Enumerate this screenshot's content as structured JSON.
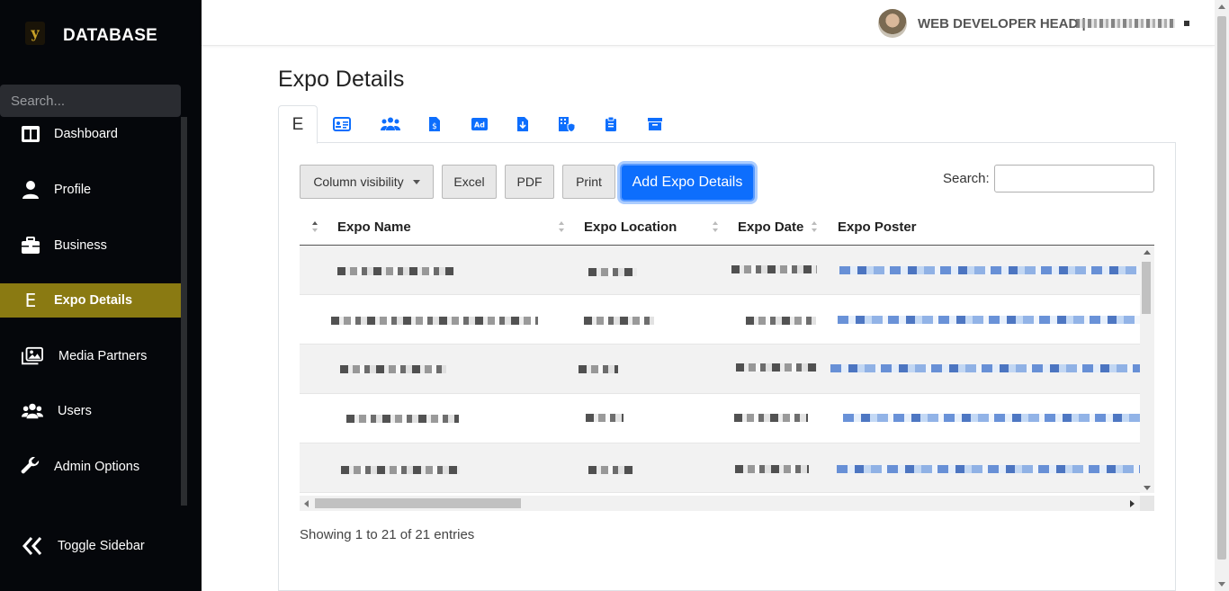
{
  "brand": {
    "logo_letter": "y",
    "name": "DATABASE"
  },
  "sidebar": {
    "search_placeholder": "Search...",
    "items": [
      {
        "label": "Dashboard",
        "icon": "columns-icon"
      },
      {
        "label": "Profile",
        "icon": "user-icon"
      },
      {
        "label": "Business",
        "icon": "briefcase-icon"
      },
      {
        "label": "Expo Details",
        "icon": "letter-e-icon",
        "icon_text": "E",
        "active": true
      },
      {
        "label": "Media Partners",
        "icon": "images-icon"
      },
      {
        "label": "Users",
        "icon": "users-icon"
      },
      {
        "label": "Admin Options",
        "icon": "wrench-icon"
      }
    ],
    "toggle_label": "Toggle Sidebar"
  },
  "topbar": {
    "user_role": "WEB DEVELOPER HEAD |"
  },
  "page": {
    "title": "Expo Details"
  },
  "tabs": [
    {
      "icon": "letter-e-icon",
      "text": "E",
      "active": true
    },
    {
      "icon": "id-card-icon"
    },
    {
      "icon": "people-group-icon"
    },
    {
      "icon": "file-dollar-icon"
    },
    {
      "icon": "ad-icon"
    },
    {
      "icon": "file-download-icon"
    },
    {
      "icon": "building-shield-icon"
    },
    {
      "icon": "clipboard-icon"
    },
    {
      "icon": "archive-icon"
    }
  ],
  "toolbar": {
    "column_visibility": "Column visibility",
    "excel": "Excel",
    "pdf": "PDF",
    "print": "Print",
    "add": "Add Expo Details",
    "search_label": "Search:"
  },
  "table": {
    "headers": [
      "Expo Name",
      "Expo Location",
      "Expo Date",
      "Expo Poster"
    ],
    "row_count_visible": 5,
    "info": "Showing 1 to 21 of 21 entries"
  },
  "colors": {
    "sidebar_bg": "#05070b",
    "active_item": "#8a7a12",
    "primary": "#0d6efd"
  }
}
